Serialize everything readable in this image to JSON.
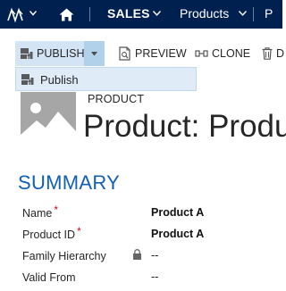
{
  "nav": {
    "logo_icon": "dynamics-logo-icon",
    "home_icon": "home-icon",
    "area_label": "SALES",
    "entity_label": "Products",
    "recent_label": "P"
  },
  "commands": {
    "publish_label": "PUBLISH",
    "preview_label": "PREVIEW",
    "clone_label": "CLONE",
    "delete_label": "D"
  },
  "publish_menu": {
    "items": [
      {
        "label": "Publish",
        "icon": "publish-icon"
      }
    ]
  },
  "entity": {
    "type_label": "PRODUCT",
    "title": "Product: Produ"
  },
  "summary": {
    "title": "SUMMARY",
    "fields": [
      {
        "label": "Name",
        "value": "Product A",
        "required": "*"
      },
      {
        "label": "Product ID",
        "value": "Product A",
        "required": "*"
      },
      {
        "label": "Family Hierarchy",
        "value": "--"
      },
      {
        "label": "Valid From",
        "value": "--"
      }
    ]
  },
  "colors": {
    "nav_bg": "#002050",
    "accent": "#1160b7",
    "required": "#d0021b",
    "selected_bg": "#d3e5f4"
  }
}
